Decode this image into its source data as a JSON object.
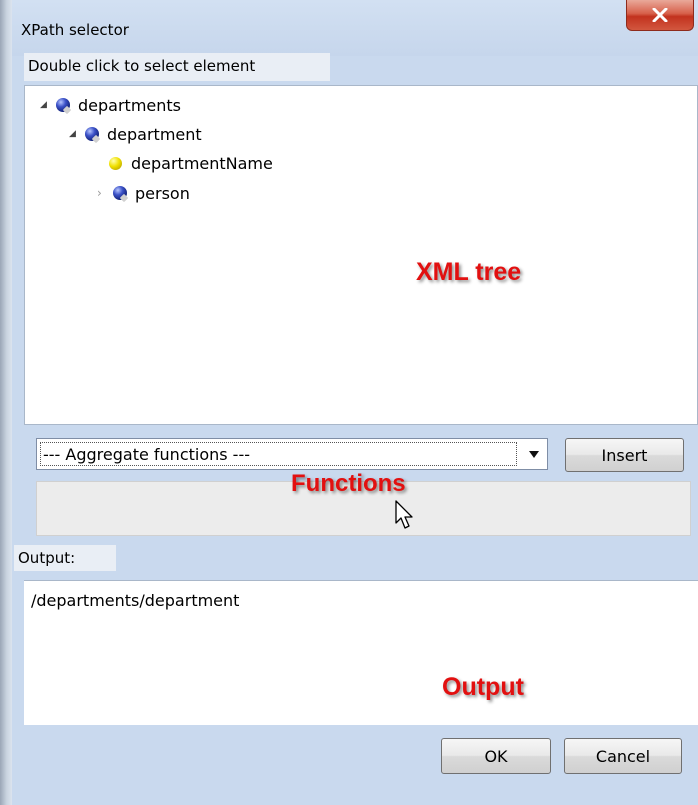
{
  "window": {
    "title": "XPath selector",
    "close_icon": "close-x-icon"
  },
  "tree_section": {
    "instruction": "Double click to select element",
    "nodes": [
      {
        "label": "departments",
        "icon": "element-node-icon",
        "expand": "expanded-arrow-icon"
      },
      {
        "label": "department",
        "icon": "element-node-icon",
        "expand": "expanded-arrow-icon"
      },
      {
        "label": "departmentName",
        "icon": "attribute-node-icon",
        "expand": ""
      },
      {
        "label": "person",
        "icon": "element-node-icon",
        "expand": "collapsed-arrow-icon"
      }
    ],
    "annotation": "XML tree"
  },
  "functions_section": {
    "dropdown_value": "--- Aggregate functions ---",
    "insert_label": "Insert",
    "annotation": "Functions"
  },
  "output_section": {
    "label": "Output:",
    "value": "/departments/department",
    "annotation": "Output"
  },
  "footer": {
    "ok_label": "OK",
    "cancel_label": "Cancel"
  },
  "colors": {
    "window_bg": "#c9d9ee",
    "annotation": "#e21010",
    "close_button": "#c2321e"
  }
}
